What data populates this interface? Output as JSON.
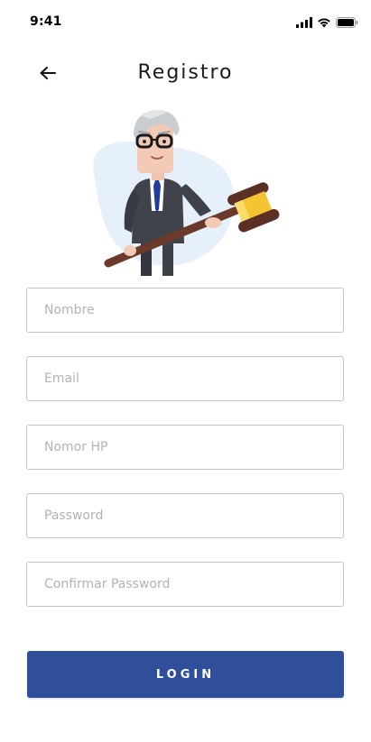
{
  "status_bar": {
    "time": "9:41",
    "icons": [
      "signal-icon",
      "wifi-icon",
      "battery-icon"
    ]
  },
  "header": {
    "back_icon": "arrow-left-icon",
    "title": "Registro"
  },
  "hero": {
    "illustration": "judge-with-gavel-illustration"
  },
  "form": {
    "fields": [
      {
        "name": "nombre",
        "placeholder": "Nombre",
        "value": ""
      },
      {
        "name": "email",
        "placeholder": "Email",
        "value": ""
      },
      {
        "name": "nomor-hp",
        "placeholder": "Nomor HP",
        "value": ""
      },
      {
        "name": "password",
        "placeholder": "Password",
        "value": ""
      },
      {
        "name": "confirm-password",
        "placeholder": "Confirmar Password",
        "value": ""
      }
    ],
    "submit_label": "LOGIN"
  },
  "colors": {
    "primary": "#2f4f9a",
    "field_border": "#c4c4c4",
    "placeholder": "#b3b3b3",
    "title": "#1b1b1b"
  }
}
